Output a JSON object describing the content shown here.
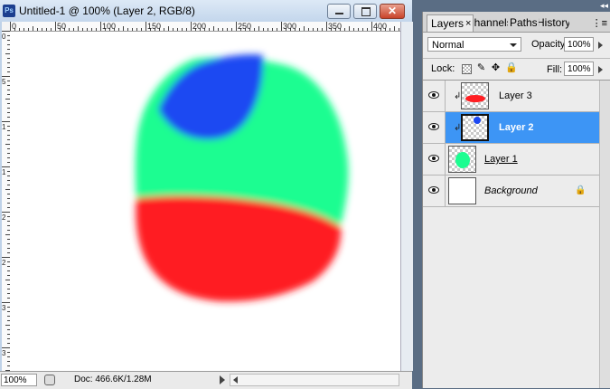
{
  "window": {
    "app_icon": "Ps",
    "title": "Untitled-1 @ 100% (Layer 2, RGB/8)",
    "close_glyph": "✕"
  },
  "ruler": {
    "h_labels": [
      "0",
      "50",
      "100",
      "150",
      "200",
      "250",
      "300",
      "350",
      "400"
    ],
    "v_labels": [
      "0",
      "5",
      "1",
      "1",
      "2",
      "2",
      "3",
      "3"
    ]
  },
  "canvas_colors": {
    "green": "#1cfd91",
    "blue": "#1c48f2",
    "red": "#ff1f23"
  },
  "status": {
    "zoom": "100%",
    "doc_info": "Doc: 466.6K/1.28M"
  },
  "panel": {
    "tabs": {
      "layers": "Layers",
      "close": "×",
      "channels": "Channels",
      "paths": "Paths",
      "history": "History"
    },
    "menu_icon": "⋮≡",
    "collapse_icon": "◂◂",
    "blend_mode": "Normal",
    "opacity_label": "Opacity:",
    "opacity_value": "100%",
    "lock_label": "Lock:",
    "lock_glyphs": {
      "brush": "✎",
      "move": "✥",
      "all": "🔒"
    },
    "fill_label": "Fill:",
    "fill_value": "100%",
    "layers": [
      {
        "name": "Layer 3",
        "visible": true,
        "selected": false,
        "clipped": true
      },
      {
        "name": "Layer 2",
        "visible": true,
        "selected": true,
        "clipped": true
      },
      {
        "name": "Layer 1",
        "visible": true,
        "selected": false,
        "clipped": false
      },
      {
        "name": "Background",
        "visible": true,
        "selected": false,
        "clipped": false,
        "locked": true
      }
    ],
    "link_glyph": "↲",
    "bg_lock_glyph": "🔒"
  }
}
